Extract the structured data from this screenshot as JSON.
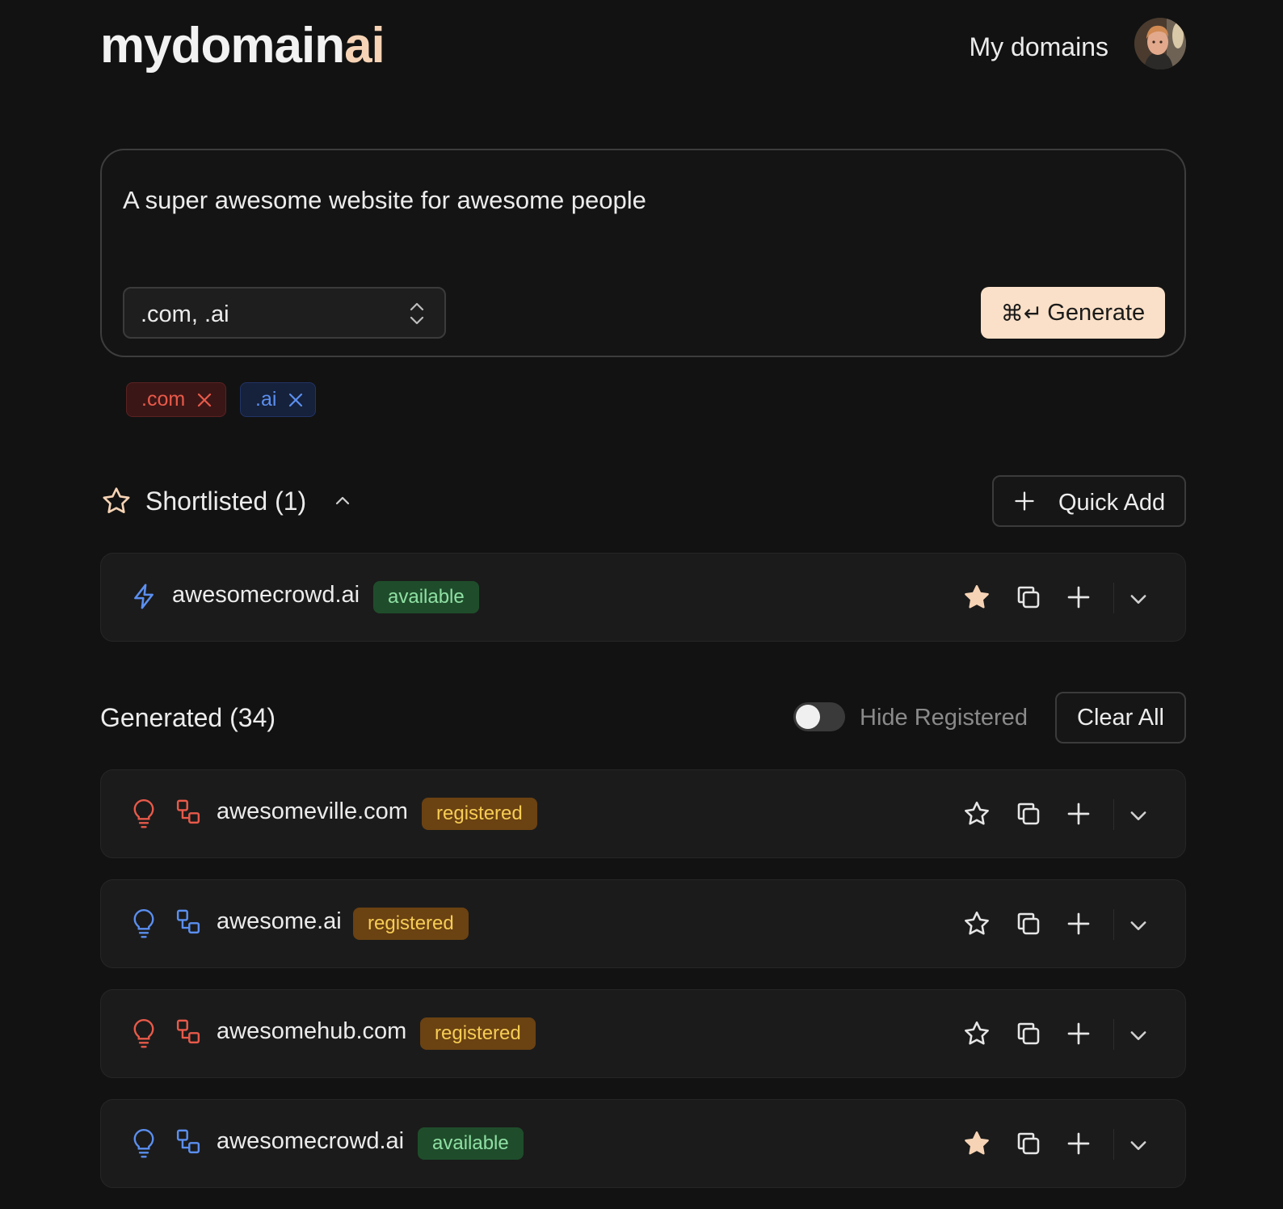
{
  "header": {
    "logo_main": "mydomain",
    "logo_accent": "ai",
    "nav_link": "My domains"
  },
  "prompt": {
    "text": "A super awesome website for awesome people",
    "tld_select_value": ".com, .ai",
    "generate_shortcut": "⌘↵",
    "generate_label": "Generate"
  },
  "chips": [
    {
      "label": ".com",
      "color": "#e85a4a"
    },
    {
      "label": ".ai",
      "color": "#5b8ff0"
    }
  ],
  "shortlisted": {
    "title": "Shortlisted (1)",
    "quick_add_label": "Quick Add",
    "items": [
      {
        "domain": "awesomecrowd.ai",
        "status": "available",
        "starred": true
      }
    ]
  },
  "generated": {
    "title": "Generated (34)",
    "hide_registered_label": "Hide Registered",
    "hide_registered_on": false,
    "clear_all_label": "Clear All",
    "items": [
      {
        "domain": "awesomeville.com",
        "status": "registered",
        "starred": false,
        "tld_color": "#e85a4a"
      },
      {
        "domain": "awesome.ai",
        "status": "registered",
        "starred": false,
        "tld_color": "#5b8ff0"
      },
      {
        "domain": "awesomehub.com",
        "status": "registered",
        "starred": false,
        "tld_color": "#e85a4a"
      },
      {
        "domain": "awesomecrowd.ai",
        "status": "available",
        "starred": true,
        "tld_color": "#5b8ff0"
      }
    ]
  }
}
